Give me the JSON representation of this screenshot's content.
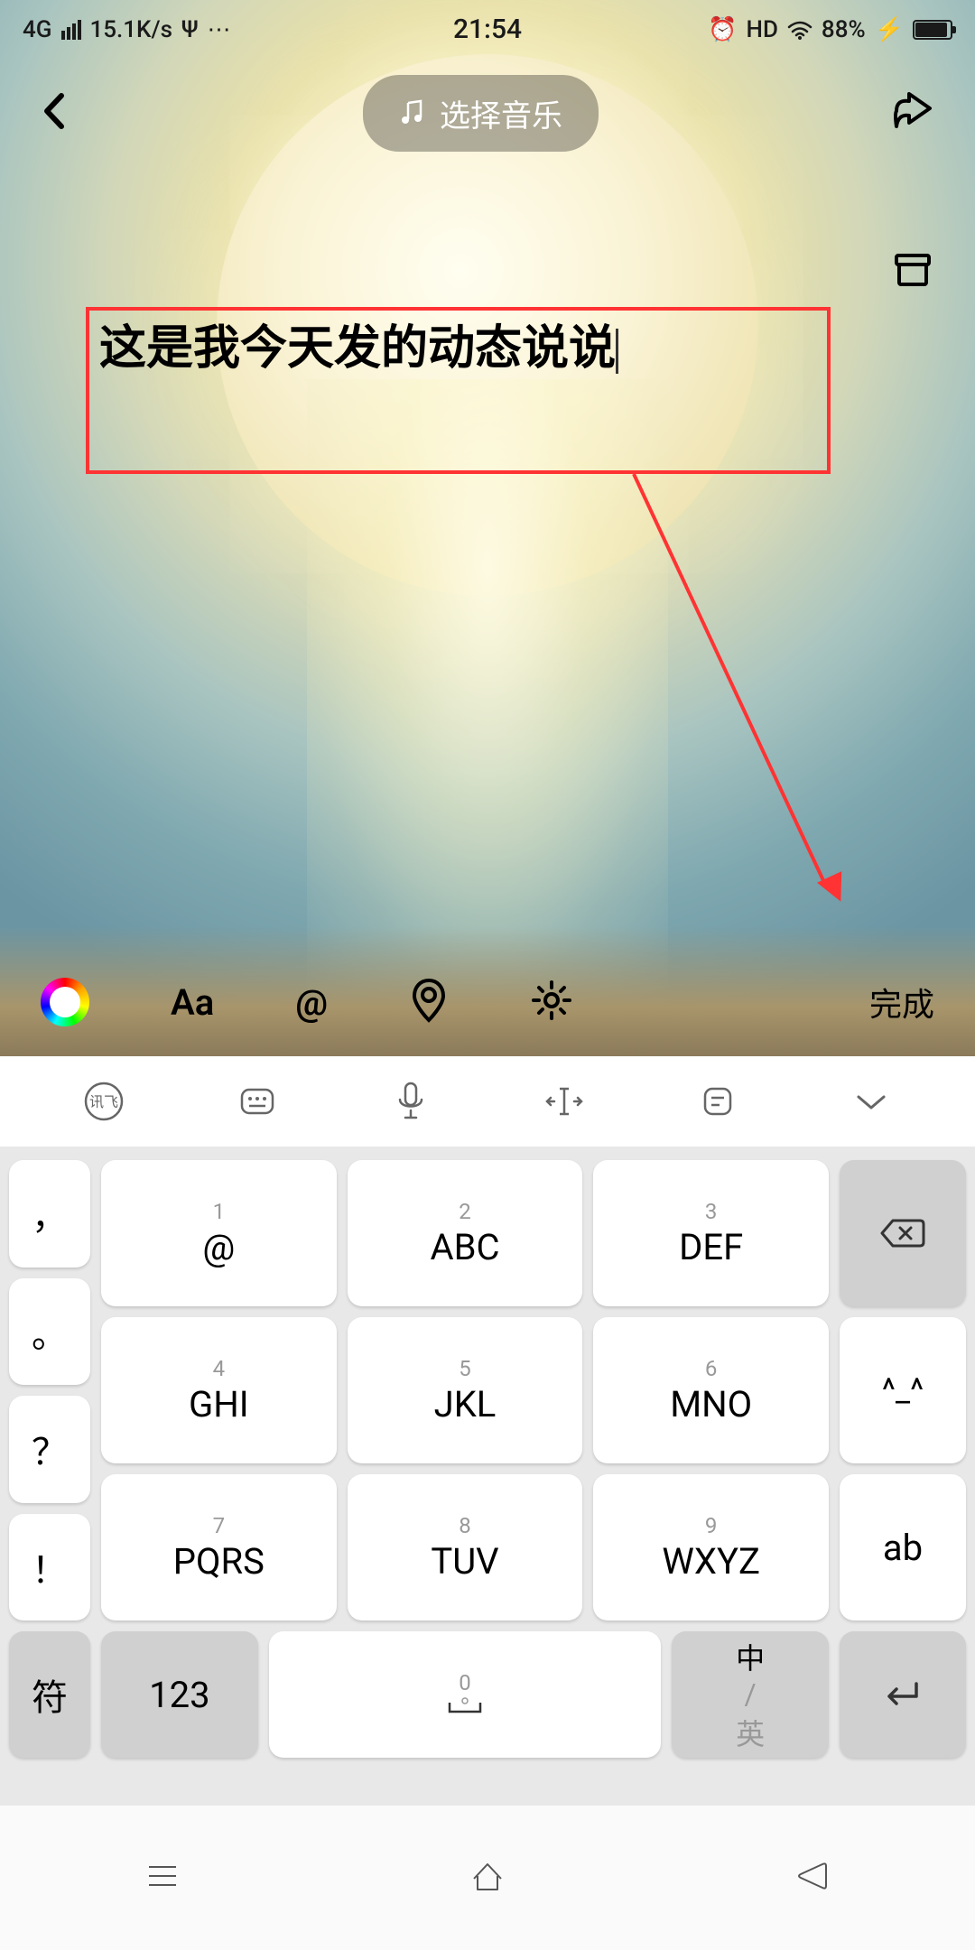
{
  "status": {
    "net": "4G",
    "speed": "15.1K/s",
    "time": "21:54",
    "hd": "HD",
    "battery": "88%"
  },
  "header": {
    "music": "选择音乐"
  },
  "editor": {
    "text": "这是我今天发的动态说说"
  },
  "toolbar": {
    "font": "Aa",
    "at": "@",
    "done": "完成"
  },
  "keyboard": {
    "punc": [
      "，",
      "。",
      "？",
      "！"
    ],
    "grid": [
      [
        {
          "n": "1",
          "m": "@"
        },
        {
          "n": "2",
          "m": "ABC"
        },
        {
          "n": "3",
          "m": "DEF"
        }
      ],
      [
        {
          "n": "4",
          "m": "GHI"
        },
        {
          "n": "5",
          "m": "JKL"
        },
        {
          "n": "6",
          "m": "MNO"
        }
      ],
      [
        {
          "n": "7",
          "m": "PQRS"
        },
        {
          "n": "8",
          "m": "TUV"
        },
        {
          "n": "9",
          "m": "WXYZ"
        }
      ]
    ],
    "actions": {
      "emoji": "^_^",
      "ab": "ab"
    },
    "bottom": {
      "sym": "符",
      "num": "123",
      "space_n": "0",
      "lang_main": "中",
      "lang_sep": "/",
      "lang_alt": "英"
    }
  }
}
